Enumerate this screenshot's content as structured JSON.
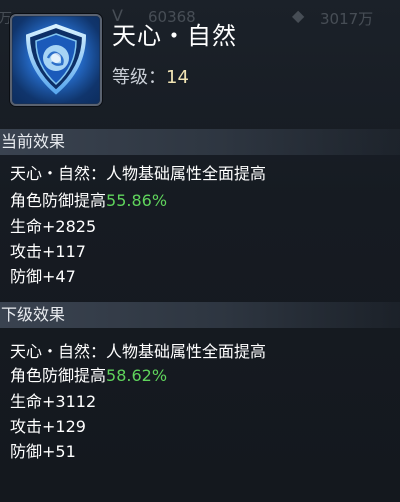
{
  "topbar": {
    "left_glyph": "万",
    "currency1_icon": "v-icon",
    "currency1_amount": "60368",
    "currency2_icon": "gem-icon",
    "currency2_amount": "3017万"
  },
  "skill": {
    "icon": "shield-icon",
    "name": "天心・自然",
    "level_label": "等级：",
    "level_value": "14"
  },
  "current_effect": {
    "header": "当前效果",
    "desc": "天心・自然：人物基础属性全面提高",
    "defense_prefix": "角色防御提高",
    "defense_value": "55.86%",
    "stats": [
      "生命+2825",
      "攻击+117",
      "防御+47"
    ]
  },
  "next_effect": {
    "header": "下级效果",
    "desc": "天心・自然：人物基础属性全面提高",
    "defense_prefix": "角色防御提高",
    "defense_value": "58.62%",
    "stats": [
      "生命+3112",
      "攻击+129",
      "防御+51"
    ]
  },
  "colors": {
    "highlight_green": "#5fd35c",
    "level_value": "#f1e4b4",
    "icon_blue": "#2a6fd6"
  }
}
